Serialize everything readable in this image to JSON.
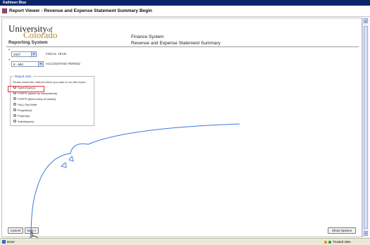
{
  "user_bar": {
    "name": "Kathleen Blue"
  },
  "window": {
    "title": "Report Viewer - Revenue and Expense Statement Summary Begin"
  },
  "logo": {
    "university": "University",
    "of": "of",
    "colorado": "Colorado",
    "reporting_system": "Reporting System"
  },
  "header": {
    "system": "Finance System",
    "report_title": "Revenue and Expense Statement Summary"
  },
  "fields": {
    "fiscal_year": {
      "value": "2007",
      "label": "FISCAL YEAR"
    },
    "accounting_period": {
      "value": "6 - Mid",
      "label": "ACCOUNTING PERIOD"
    }
  },
  "report_size": {
    "legend": "Report Size",
    "instruction": "Please select the method which you want to run this report",
    "options": [
      "SpeedType(s)",
      "FOPPS (select by components)",
      "FOPPS (direct entry of values)",
      "Org | Org Node",
      "Program(s)",
      "Project(s)",
      "Subclass(es)"
    ]
  },
  "buttons": {
    "cancel": "Cancel",
    "next": "Next >",
    "show_options": "Show Options"
  },
  "status": {
    "done": "Done",
    "zone": "Trusted sites"
  },
  "colors": {
    "highlight": "#e53232",
    "gesture": "#3a78e0",
    "brand_gold": "#b28b2f",
    "title_bar": "#0a246a"
  }
}
